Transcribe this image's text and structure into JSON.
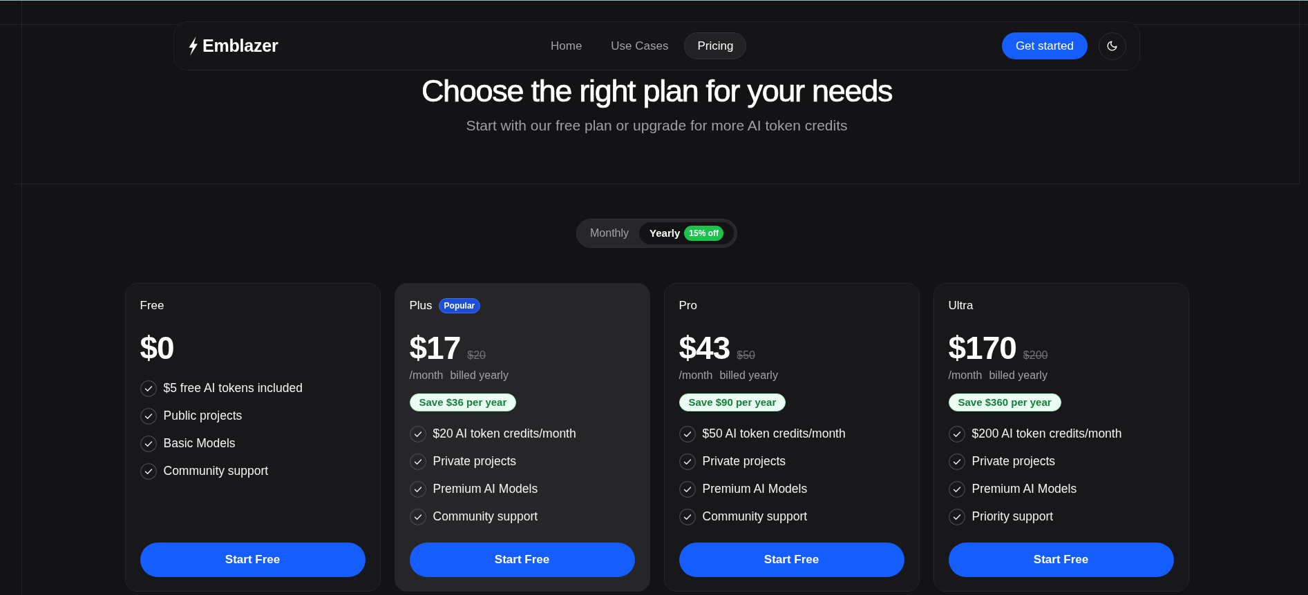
{
  "nav": {
    "logo": "Emblazer",
    "links": [
      {
        "label": "Home",
        "selected": false
      },
      {
        "label": "Use Cases",
        "selected": false
      },
      {
        "label": "Pricing",
        "selected": true
      }
    ],
    "cta": "Get started"
  },
  "hero": {
    "title": "Choose the right plan for your needs",
    "subtitle": "Start with our free plan or upgrade for more AI token credits"
  },
  "billing_toggle": [
    {
      "label": "Monthly",
      "selected": false
    },
    {
      "label": "Yearly",
      "selected": true,
      "badge": "15% off"
    }
  ],
  "plans": [
    {
      "name": "Free",
      "highlighted": false,
      "price": "$0",
      "features": [
        "$5 free AI tokens included",
        "Public projects",
        "Basic Models",
        "Community support"
      ],
      "button": "Start Free"
    },
    {
      "name": "Plus",
      "badge": "Popular",
      "highlighted": true,
      "price": "$17",
      "old_price": "$20",
      "period": "/month",
      "billing": "billed yearly",
      "savings": "Save $36 per year",
      "features": [
        "$20 AI token credits/month",
        "Private projects",
        "Premium AI Models",
        "Community support"
      ],
      "button": "Start Free"
    },
    {
      "name": "Pro",
      "highlighted": false,
      "price": "$43",
      "old_price": "$50",
      "period": "/month",
      "billing": "billed yearly",
      "savings": "Save $90 per year",
      "features": [
        "$50 AI token credits/month",
        "Private projects",
        "Premium AI Models",
        "Community support"
      ],
      "button": "Start Free"
    },
    {
      "name": "Ultra",
      "highlighted": false,
      "price": "$170",
      "old_price": "$200",
      "period": "/month",
      "billing": "billed yearly",
      "savings": "Save $360 per year",
      "features": [
        "$200 AI token credits/month",
        "Private projects",
        "Premium AI Models",
        "Priority support"
      ],
      "button": "Start Free"
    }
  ]
}
